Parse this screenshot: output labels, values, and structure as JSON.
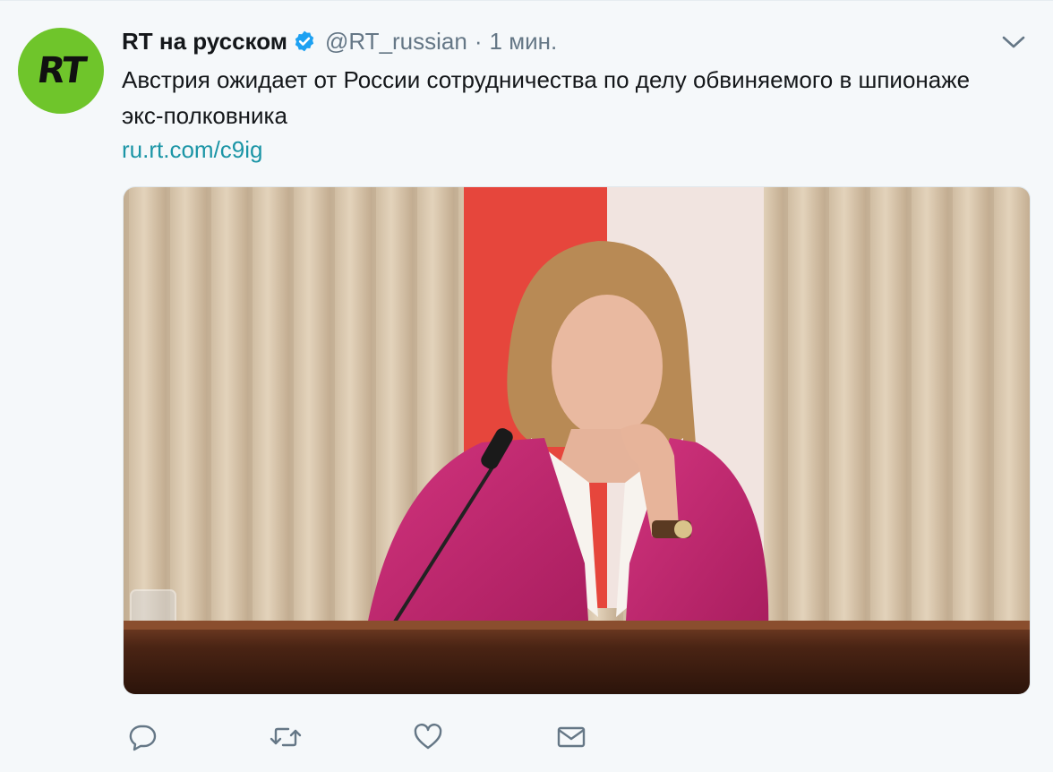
{
  "tweet": {
    "author_name": "RT на русском",
    "handle": "@RT_russian",
    "separator": "·",
    "time": "1 мин.",
    "text": "Австрия ожидает от России сотрудничества по делу обвиняемого в шпионаже экс-полковника",
    "link": "ru.rt.com/c9ig",
    "avatar_text": "RT"
  },
  "icons": {
    "verified": "verified-badge-icon",
    "menu": "chevron-down-icon",
    "reply": "reply-icon",
    "retweet": "retweet-icon",
    "like": "heart-icon",
    "dm": "envelope-icon"
  },
  "colors": {
    "background": "#f5f8fa",
    "link": "#1b95a6",
    "verified": "#1da1f2",
    "muted": "#657786",
    "avatar": "#6fc52b"
  }
}
